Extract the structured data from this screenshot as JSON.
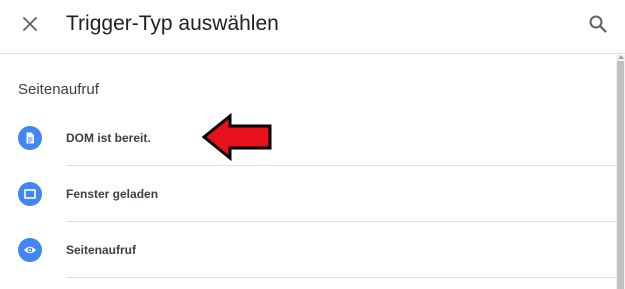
{
  "header": {
    "title": "Trigger-Typ auswählen",
    "close_icon": "close-icon",
    "search_icon": "search-icon"
  },
  "section": {
    "heading": "Seitenaufruf"
  },
  "items": [
    {
      "label": "DOM ist bereit.",
      "icon": "document-icon"
    },
    {
      "label": "Fenster geladen",
      "icon": "window-icon"
    },
    {
      "label": "Seitenaufruf",
      "icon": "eye-icon"
    }
  ],
  "colors": {
    "icon_background": "#4285f4",
    "annotation_arrow": "#e8101a",
    "divider": "#dadce0",
    "title_text": "#202124",
    "icon_gray": "#5f6368"
  }
}
